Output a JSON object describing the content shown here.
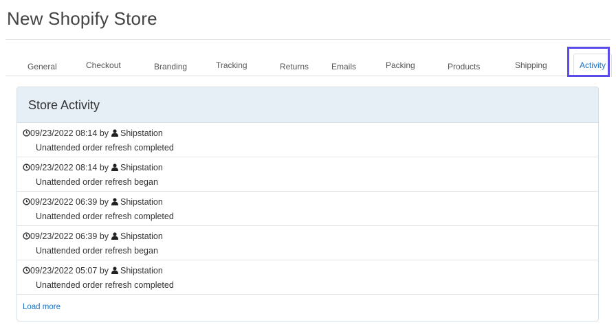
{
  "page": {
    "title": "New Shopify Store"
  },
  "tabs": [
    {
      "label": "General",
      "active": false
    },
    {
      "label": "Checkout",
      "active": false
    },
    {
      "label": "Branding",
      "active": false
    },
    {
      "label": "Tracking",
      "active": false
    },
    {
      "label": "Returns",
      "active": false
    },
    {
      "label": "Emails",
      "active": false
    },
    {
      "label": "Packing",
      "active": false
    },
    {
      "label": "Products",
      "active": false
    },
    {
      "label": "Shipping",
      "active": false
    },
    {
      "label": "Activity",
      "active": true
    }
  ],
  "panel": {
    "title": "Store Activity",
    "items": [
      {
        "timestamp": "09/23/2022 08:14",
        "by": "by",
        "user": "Shipstation",
        "description": "Unattended order refresh completed"
      },
      {
        "timestamp": "09/23/2022 08:14",
        "by": "by",
        "user": "Shipstation",
        "description": "Unattended order refresh began"
      },
      {
        "timestamp": "09/23/2022 06:39",
        "by": "by",
        "user": "Shipstation",
        "description": "Unattended order refresh completed"
      },
      {
        "timestamp": "09/23/2022 06:39",
        "by": "by",
        "user": "Shipstation",
        "description": "Unattended order refresh began"
      },
      {
        "timestamp": "09/23/2022 05:07",
        "by": "by",
        "user": "Shipstation",
        "description": "Unattended order refresh completed"
      }
    ],
    "load_more_label": "Load more"
  },
  "colors": {
    "link": "#1a73c8",
    "panel_header_bg": "#e6eef6",
    "highlight_border": "#5b4be8"
  },
  "icons": {
    "timestamp": "clock-icon",
    "user": "user-icon"
  }
}
